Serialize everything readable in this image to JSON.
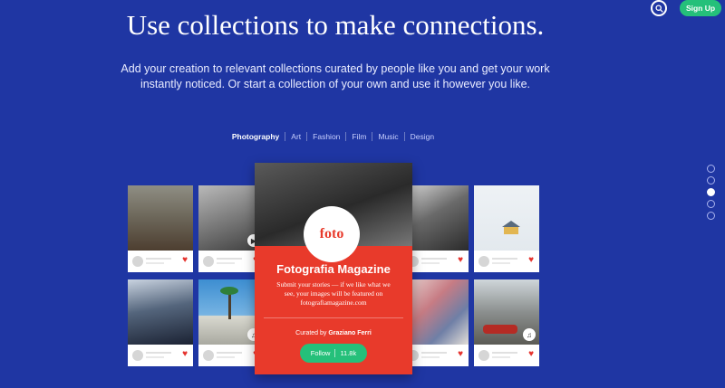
{
  "header": {
    "signup_label": "Sign Up"
  },
  "hero": {
    "title": "Use collections to make connections.",
    "subtitle": "Add your creation to relevant collections curated by people like you and get your work instantly noticed. Or start a collection of your own and use it however you like."
  },
  "tabs": [
    "Photography",
    "Art",
    "Fashion",
    "Film",
    "Music",
    "Design"
  ],
  "active_tab": "Photography",
  "pager": {
    "count": 5,
    "active_index": 3
  },
  "featured": {
    "logo_text": "foto",
    "name": "Fotografia Magazine",
    "description": "Submit your stories — if we like what we see, your images will be featured on fotografiamagazine.com",
    "curated_prefix": "Curated by",
    "curator": "Graziano Ferri",
    "follow_label": "Follow",
    "follower_count": "11.8k"
  },
  "colors": {
    "background": "#1f36a3",
    "accent_green": "#25c07a",
    "featured_red": "#e83a2b",
    "heart": "#e5322d"
  }
}
